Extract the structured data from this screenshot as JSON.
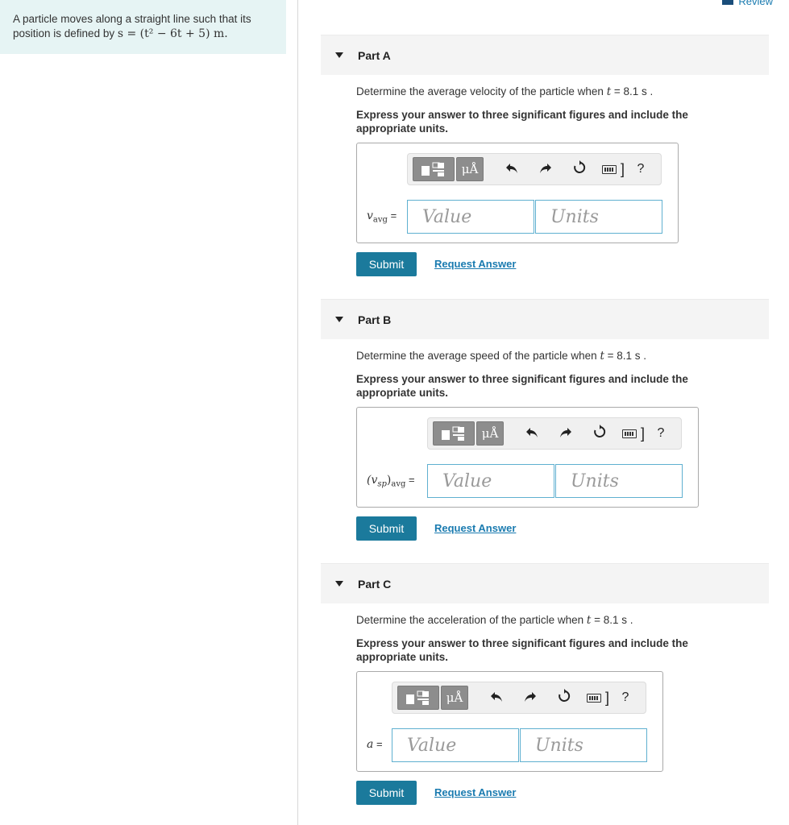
{
  "problem": {
    "line1": "A particle moves along a straight line such that its",
    "line2_prefix": "position is defined by",
    "line2_math": "s = (t² − 6t + 5) m."
  },
  "review": {
    "label": "Review"
  },
  "parts": [
    {
      "title": "Part A",
      "question_prefix": "Determine the average velocity of the particle when",
      "question_var": "t",
      "question_suffix": "= 8.1  s .",
      "instructions": "Express your answer to three significant figures and include the appropriate units.",
      "var_label": "v",
      "var_sub": "avg",
      "equals": "=",
      "value_placeholder": "Value",
      "units_placeholder": "Units",
      "submit": "Submit",
      "request": "Request Answer"
    },
    {
      "title": "Part B",
      "question_prefix": "Determine the average speed of the particle when",
      "question_var": "t",
      "question_suffix": "= 8.1  s .",
      "instructions": "Express your answer to three significant figures and include the appropriate units.",
      "var_label": "(v",
      "var_sub_inner": "sp",
      "var_close": ")",
      "var_sub": "avg",
      "equals": "=",
      "value_placeholder": "Value",
      "units_placeholder": "Units",
      "submit": "Submit",
      "request": "Request Answer"
    },
    {
      "title": "Part C",
      "question_prefix": "Determine the acceleration of the particle when",
      "question_var": "t",
      "question_suffix": "= 8.1  s .",
      "instructions": "Express your answer to three significant figures and include the appropriate units.",
      "var_label": "a",
      "equals": "=",
      "value_placeholder": "Value",
      "units_placeholder": "Units",
      "submit": "Submit",
      "request": "Request Answer"
    }
  ],
  "toolbar": {
    "units_symbol": "μÅ",
    "undo_icon": "undo-icon",
    "redo_icon": "redo-icon",
    "reset_icon": "reset-icon",
    "keyboard_icon": "keyboard-icon",
    "help_label": "?"
  }
}
